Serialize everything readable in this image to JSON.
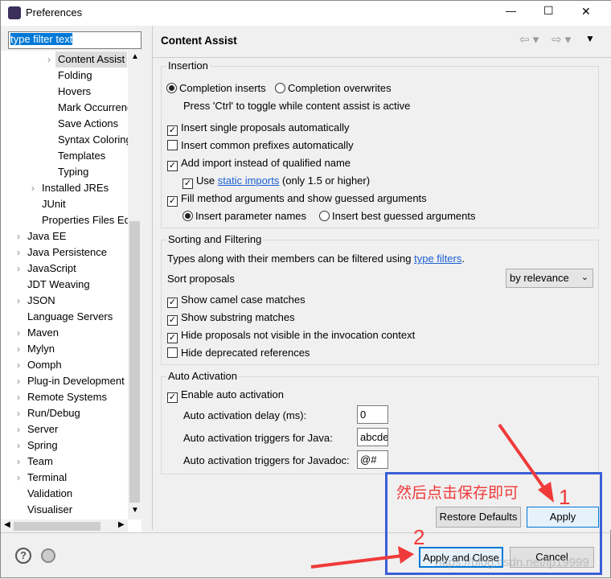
{
  "window": {
    "title": "Preferences",
    "minimize": "—",
    "maximize": "☐",
    "close": "✕"
  },
  "filter": {
    "value": "type filter text"
  },
  "tree": {
    "items": [
      {
        "label": "Content Assist",
        "arrow": true,
        "level": 3,
        "selected": true
      },
      {
        "label": "Folding",
        "level": 3
      },
      {
        "label": "Hovers",
        "level": 3
      },
      {
        "label": "Mark Occurrences",
        "level": 3
      },
      {
        "label": "Save Actions",
        "level": 3
      },
      {
        "label": "Syntax Coloring",
        "level": 3
      },
      {
        "label": "Templates",
        "level": 3
      },
      {
        "label": "Typing",
        "level": 3
      },
      {
        "label": "Installed JREs",
        "arrow": true,
        "level": 2
      },
      {
        "label": "JUnit",
        "level": 2
      },
      {
        "label": "Properties Files Editor",
        "level": 2
      },
      {
        "label": "Java EE",
        "arrow": true,
        "level": 1
      },
      {
        "label": "Java Persistence",
        "arrow": true,
        "level": 1
      },
      {
        "label": "JavaScript",
        "arrow": true,
        "level": 1
      },
      {
        "label": "JDT Weaving",
        "level": 1
      },
      {
        "label": "JSON",
        "arrow": true,
        "level": 1
      },
      {
        "label": "Language Servers",
        "level": 1
      },
      {
        "label": "Maven",
        "arrow": true,
        "level": 1
      },
      {
        "label": "Mylyn",
        "arrow": true,
        "level": 1
      },
      {
        "label": "Oomph",
        "arrow": true,
        "level": 1
      },
      {
        "label": "Plug-in Development",
        "arrow": true,
        "level": 1
      },
      {
        "label": "Remote Systems",
        "arrow": true,
        "level": 1
      },
      {
        "label": "Run/Debug",
        "arrow": true,
        "level": 1
      },
      {
        "label": "Server",
        "arrow": true,
        "level": 1
      },
      {
        "label": "Spring",
        "arrow": true,
        "level": 1
      },
      {
        "label": "Team",
        "arrow": true,
        "level": 1
      },
      {
        "label": "Terminal",
        "arrow": true,
        "level": 1
      },
      {
        "label": "Validation",
        "level": 1
      },
      {
        "label": "Visualiser",
        "level": 1
      }
    ]
  },
  "page": {
    "title": "Content Assist"
  },
  "insertion": {
    "label": "Insertion",
    "completion_inserts": "Completion inserts",
    "completion_overwrites": "Completion overwrites",
    "hint": "Press 'Ctrl' to toggle while content assist is active",
    "single": "Insert single proposals automatically",
    "prefixes": "Insert common prefixes automatically",
    "add_import": "Add import instead of qualified name",
    "use": "Use",
    "static_imports": "static imports",
    "static_suffix": "(only 1.5 or higher)",
    "fill_args": "Fill method arguments and show guessed arguments",
    "param_names": "Insert parameter names",
    "best_guessed": "Insert best guessed arguments"
  },
  "sorting": {
    "label": "Sorting and Filtering",
    "desc": "Types along with their members can be filtered using",
    "type_filters": "type filters",
    "period": ".",
    "sort_label": "Sort proposals",
    "sort_value": "by relevance",
    "camel": "Show camel case matches",
    "substring": "Show substring matches",
    "hide_not_visible": "Hide proposals not visible in the invocation context",
    "hide_deprecated": "Hide deprecated references"
  },
  "auto": {
    "label": "Auto Activation",
    "enable": "Enable auto activation",
    "delay_label": "Auto activation delay (ms):",
    "delay": "0",
    "java_label": "Auto activation triggers for Java:",
    "java": "abcdefghijklmnopqrstuvwxyz",
    "javadoc_label": "Auto activation triggers for Javadoc:",
    "javadoc": "@#"
  },
  "buttons": {
    "restore": "Restore Defaults",
    "apply": "Apply",
    "apply_close": "Apply and Close",
    "cancel": "Cancel"
  },
  "annotation": {
    "note": "然后点击保存即可",
    "step1": "1",
    "step2": "2",
    "color": "#f03a3a",
    "box_color": "#3a5fd8"
  },
  "watermark": "https://blog.csdn.net/lp19999"
}
